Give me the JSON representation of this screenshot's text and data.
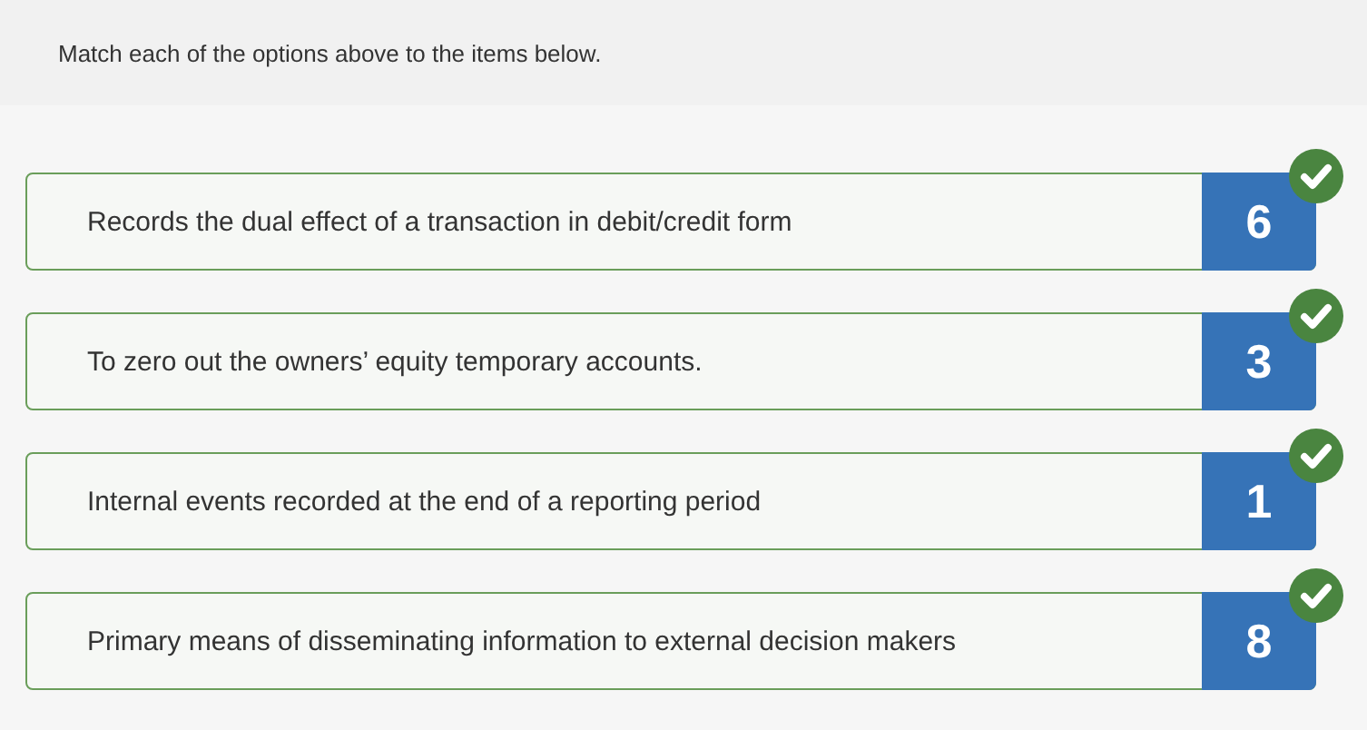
{
  "instructions": "Match each of the options above to the items below.",
  "items": [
    {
      "text": "Records the dual effect of a transaction in debit/credit form",
      "answer": "6",
      "correct": true
    },
    {
      "text": "To zero out the owners’ equity temporary accounts.",
      "answer": "3",
      "correct": true
    },
    {
      "text": "Internal events recorded at the end of a reporting period",
      "answer": "1",
      "correct": true
    },
    {
      "text": "Primary means of disseminating information to external decision makers",
      "answer": "8",
      "correct": true
    }
  ]
}
